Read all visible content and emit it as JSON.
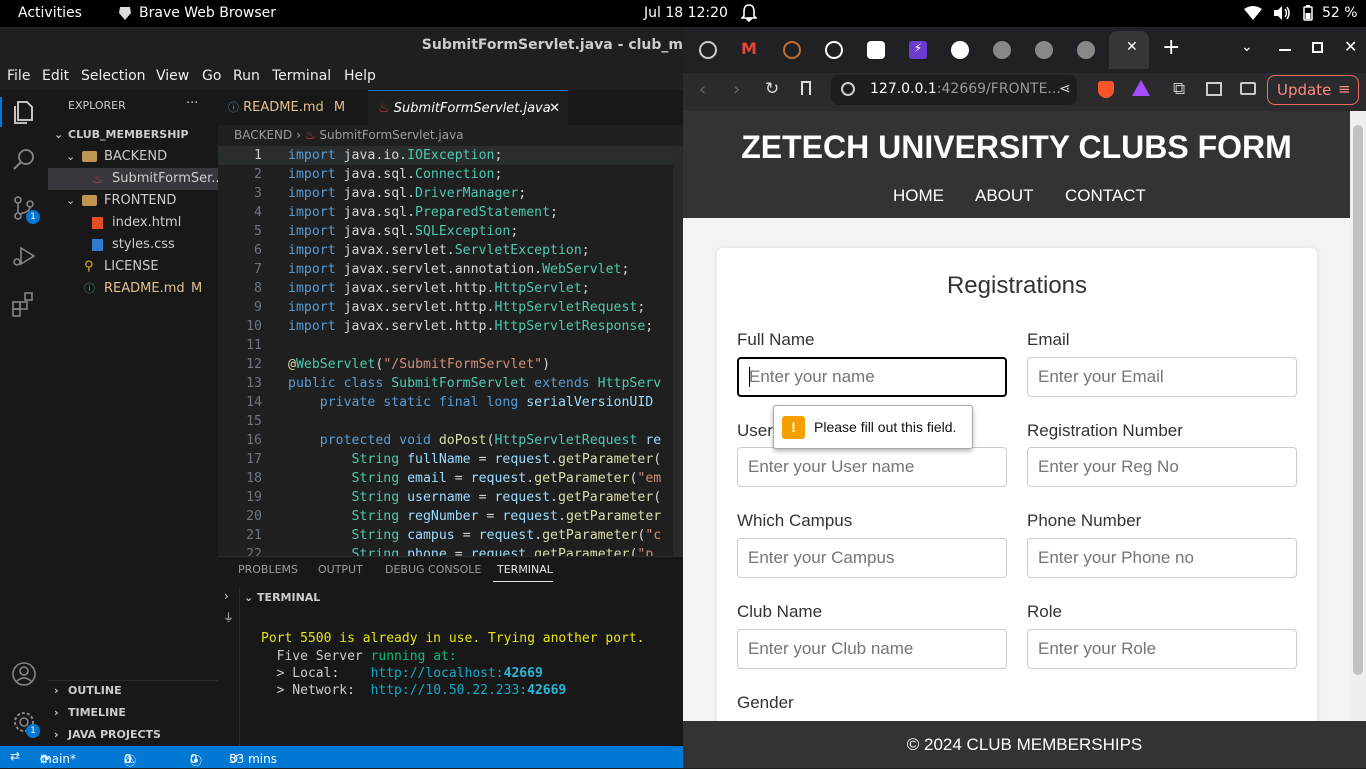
{
  "topbar": {
    "activities": "Activities",
    "app_name": "Brave Web Browser",
    "datetime": "Jul 18  12:20",
    "battery": "52 %"
  },
  "vscode": {
    "title": "SubmitFormServlet.java - club_m",
    "menu": [
      "File",
      "Edit",
      "Selection",
      "View",
      "Go",
      "Run",
      "Terminal",
      "Help"
    ],
    "explorer_header": "EXPLORER",
    "explorer_more": "···",
    "scm_badge": "1",
    "settings_badge": "1",
    "tree": [
      {
        "label": "CLUB_MEMBERSHIP",
        "arrow": "⌄",
        "icon": ""
      },
      {
        "label": "BACKEND",
        "arrow": "⌄",
        "icon": "folder"
      },
      {
        "label": "SubmitFormSer...",
        "arrow": "",
        "icon": "java"
      },
      {
        "label": "FRONTEND",
        "arrow": "⌄",
        "icon": "folder"
      },
      {
        "label": "index.html",
        "arrow": "",
        "icon": "html"
      },
      {
        "label": "styles.css",
        "arrow": "",
        "icon": "css"
      },
      {
        "label": "LICENSE",
        "arrow": "",
        "icon": "license"
      },
      {
        "label": "README.md",
        "arrow": "",
        "icon": "markdown",
        "badge": "M"
      }
    ],
    "sections": [
      "OUTLINE",
      "TIMELINE",
      "JAVA PROJECTS"
    ],
    "tabs": [
      {
        "label": "README.md",
        "badge": "M"
      },
      {
        "label": "SubmitFormServlet.java",
        "close": "✕"
      }
    ],
    "breadcrumb": [
      "BACKEND",
      "›",
      "SubmitFormServlet.java"
    ],
    "code_lines": [
      [
        [
          "kw",
          "import "
        ],
        [
          "pl",
          "java.io."
        ],
        [
          "ty",
          "IOException"
        ],
        [
          "pl",
          ";"
        ]
      ],
      [
        [
          "kw",
          "import "
        ],
        [
          "pl",
          "java.sql."
        ],
        [
          "ty",
          "Connection"
        ],
        [
          "pl",
          ";"
        ]
      ],
      [
        [
          "kw",
          "import "
        ],
        [
          "pl",
          "java.sql."
        ],
        [
          "ty",
          "DriverManager"
        ],
        [
          "pl",
          ";"
        ]
      ],
      [
        [
          "kw",
          "import "
        ],
        [
          "pl",
          "java.sql."
        ],
        [
          "ty",
          "PreparedStatement"
        ],
        [
          "pl",
          ";"
        ]
      ],
      [
        [
          "kw",
          "import "
        ],
        [
          "pl",
          "java.sql."
        ],
        [
          "ty",
          "SQLException"
        ],
        [
          "pl",
          ";"
        ]
      ],
      [
        [
          "kw",
          "import "
        ],
        [
          "pl",
          "javax.servlet."
        ],
        [
          "ty",
          "ServletException"
        ],
        [
          "pl",
          ";"
        ]
      ],
      [
        [
          "kw",
          "import "
        ],
        [
          "pl",
          "javax.servlet.annotation."
        ],
        [
          "ty",
          "WebServlet"
        ],
        [
          "pl",
          ";"
        ]
      ],
      [
        [
          "kw",
          "import "
        ],
        [
          "pl",
          "javax.servlet.http."
        ],
        [
          "ty",
          "HttpServlet"
        ],
        [
          "pl",
          ";"
        ]
      ],
      [
        [
          "kw",
          "import "
        ],
        [
          "pl",
          "javax.servlet.http."
        ],
        [
          "ty",
          "HttpServletRequest"
        ],
        [
          "pl",
          ";"
        ]
      ],
      [
        [
          "kw",
          "import "
        ],
        [
          "pl",
          "javax.servlet.http."
        ],
        [
          "ty",
          "HttpServletResponse"
        ],
        [
          "pl",
          ";"
        ]
      ],
      [],
      [
        [
          "an",
          "@"
        ],
        [
          "ty",
          "WebServlet"
        ],
        [
          "pl",
          "("
        ],
        [
          "st",
          "\"/SubmitFormServlet\""
        ],
        [
          "pl",
          ")"
        ]
      ],
      [
        [
          "kw",
          "public class "
        ],
        [
          "ty",
          "SubmitFormServlet "
        ],
        [
          "kw",
          "extends "
        ],
        [
          "ty",
          "HttpServ"
        ]
      ],
      [
        [
          "pl",
          "    "
        ],
        [
          "kw",
          "private static final long "
        ],
        [
          "vr",
          "serialVersionUID"
        ]
      ],
      [],
      [
        [
          "pl",
          "    "
        ],
        [
          "kw",
          "protected void "
        ],
        [
          "fn",
          "doPost"
        ],
        [
          "pl",
          "("
        ],
        [
          "ty",
          "HttpServletRequest "
        ],
        [
          "vr",
          "re"
        ]
      ],
      [
        [
          "pl",
          "        "
        ],
        [
          "ty",
          "String "
        ],
        [
          "vr",
          "fullName "
        ],
        [
          "pl",
          "= "
        ],
        [
          "vr",
          "request"
        ],
        [
          "pl",
          "."
        ],
        [
          "fn",
          "getParameter"
        ],
        [
          "pl",
          "("
        ]
      ],
      [
        [
          "pl",
          "        "
        ],
        [
          "ty",
          "String "
        ],
        [
          "vr",
          "email "
        ],
        [
          "pl",
          "= "
        ],
        [
          "vr",
          "request"
        ],
        [
          "pl",
          "."
        ],
        [
          "fn",
          "getParameter"
        ],
        [
          "pl",
          "("
        ],
        [
          "st",
          "\"em"
        ]
      ],
      [
        [
          "pl",
          "        "
        ],
        [
          "ty",
          "String "
        ],
        [
          "vr",
          "username "
        ],
        [
          "pl",
          "= "
        ],
        [
          "vr",
          "request"
        ],
        [
          "pl",
          "."
        ],
        [
          "fn",
          "getParameter"
        ],
        [
          "pl",
          "("
        ]
      ],
      [
        [
          "pl",
          "        "
        ],
        [
          "ty",
          "String "
        ],
        [
          "vr",
          "regNumber "
        ],
        [
          "pl",
          "= "
        ],
        [
          "vr",
          "request"
        ],
        [
          "pl",
          "."
        ],
        [
          "fn",
          "getParameter"
        ]
      ],
      [
        [
          "pl",
          "        "
        ],
        [
          "ty",
          "String "
        ],
        [
          "vr",
          "campus "
        ],
        [
          "pl",
          "= "
        ],
        [
          "vr",
          "request"
        ],
        [
          "pl",
          "."
        ],
        [
          "fn",
          "getParameter"
        ],
        [
          "pl",
          "("
        ],
        [
          "st",
          "\"c"
        ]
      ],
      [
        [
          "pl",
          "        "
        ],
        [
          "ty",
          "String "
        ],
        [
          "vr",
          "phone "
        ],
        [
          "pl",
          "= "
        ],
        [
          "vr",
          "request"
        ],
        [
          "pl",
          "."
        ],
        [
          "fn",
          "getParameter"
        ],
        [
          "pl",
          "("
        ],
        [
          "st",
          "\"p"
        ]
      ]
    ],
    "panel_tabs": [
      "PROBLEMS",
      "OUTPUT",
      "DEBUG CONSOLE",
      "TERMINAL"
    ],
    "terminal_header": "TERMINAL",
    "terminal": {
      "line1": "Port 5500 is already in use. Trying another port.",
      "line2a": "  Five Server ",
      "line2b": "running at:",
      "line3a": "  > Local:    ",
      "line3b": "http://localhost:",
      "line3c": "42669",
      "line4a": "  > Network:  ",
      "line4b": "http://10.50.22.233:",
      "line4c": "42669"
    },
    "status": {
      "branch": "main*",
      "sync_icon": "⟳",
      "errors": "0",
      "warnings": "0",
      "ports": "0",
      "time": "53 mins"
    }
  },
  "browser": {
    "url_main": "127.0.0.1",
    "url_rest": ":42669/FRONTE...",
    "update_label": "Update",
    "tab_close": "✕",
    "new_tab": "+",
    "page": {
      "title": "ZETECH UNIVERSITY CLUBS FORM",
      "nav": [
        "HOME",
        "ABOUT",
        "CONTACT"
      ],
      "form_title": "Registrations",
      "fields": [
        {
          "label": "Full Name",
          "placeholder": "Enter your name",
          "focused": true
        },
        {
          "label": "Email",
          "placeholder": "Enter your Email"
        },
        {
          "label": "User name",
          "placeholder": "Enter your User name"
        },
        {
          "label": "Registration Number",
          "placeholder": "Enter your Reg No"
        },
        {
          "label": "Which Campus",
          "placeholder": "Enter your Campus"
        },
        {
          "label": "Phone Number",
          "placeholder": "Enter your Phone no"
        },
        {
          "label": "Club Name",
          "placeholder": "Enter your Club name"
        },
        {
          "label": "Role",
          "placeholder": "Enter your Role"
        }
      ],
      "gender_label": "Gender",
      "tooltip": "Please fill out this field.",
      "tooltip_mark": "!",
      "footer": "© 2024 CLUB MEMBERSHIPS"
    }
  },
  "colors": {
    "accent": "#0078d4",
    "header_bg": "#333333",
    "warning": "#f59f00",
    "update": "#f76c60"
  }
}
